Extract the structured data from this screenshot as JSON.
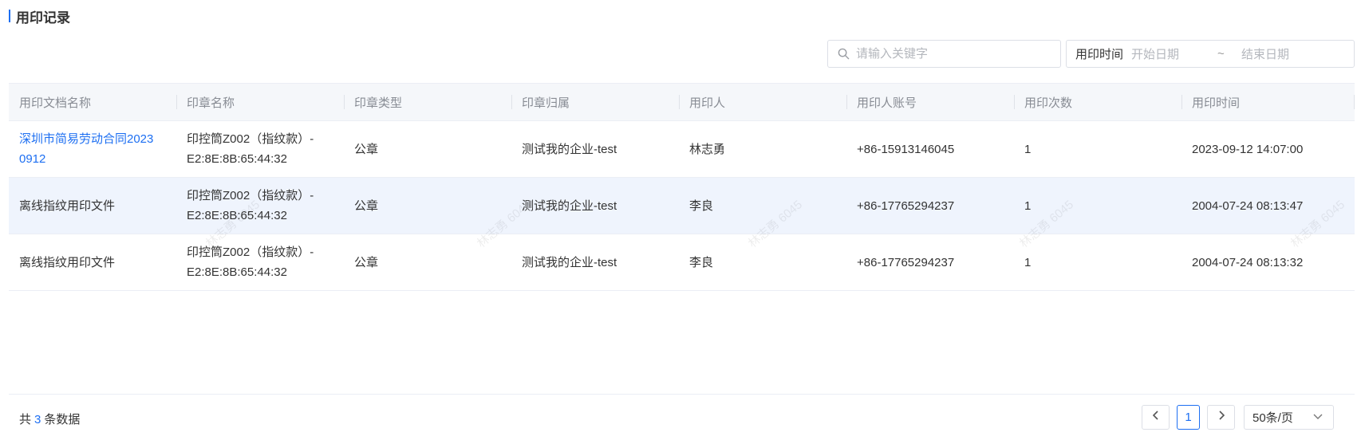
{
  "page": {
    "title": "用印记录"
  },
  "filters": {
    "search_placeholder": "请输入关键字",
    "date_label": "用印时间",
    "start_placeholder": "开始日期",
    "separator": "~",
    "end_placeholder": "结束日期"
  },
  "table": {
    "columns": [
      "用印文档名称",
      "印章名称",
      "印章类型",
      "印章归属",
      "用印人",
      "用印人账号",
      "用印次数",
      "用印时间"
    ],
    "rows": [
      {
        "doc_name_line1": "深圳市简易劳动合同2023",
        "doc_name_line2": "0912",
        "seal_name_line1": "印控筒Z002（指纹款）-",
        "seal_name_line2": "E2:8E:8B:65:44:32",
        "seal_type": "公章",
        "seal_owner": "测试我的企业-test",
        "user": "林志勇",
        "account": "+86-15913146045",
        "times": "1",
        "time": "2023-09-12 14:07:00"
      },
      {
        "doc_name_line1": "离线指纹用印文件",
        "doc_name_line2": "",
        "seal_name_line1": "印控筒Z002（指纹款）-",
        "seal_name_line2": "E2:8E:8B:65:44:32",
        "seal_type": "公章",
        "seal_owner": "测试我的企业-test",
        "user": "李良",
        "account": "+86-17765294237",
        "times": "1",
        "time": "2004-07-24 08:13:47"
      },
      {
        "doc_name_line1": "离线指纹用印文件",
        "doc_name_line2": "",
        "seal_name_line1": "印控筒Z002（指纹款）-",
        "seal_name_line2": "E2:8E:8B:65:44:32",
        "seal_type": "公章",
        "seal_owner": "测试我的企业-test",
        "user": "李良",
        "account": "+86-17765294237",
        "times": "1",
        "time": "2004-07-24 08:13:32"
      }
    ]
  },
  "watermark": {
    "text": "林志勇 6045"
  },
  "pagination": {
    "total_prefix": "共",
    "total_count": "3",
    "total_suffix": "条数据",
    "current_page": "1",
    "page_size": "50条/页"
  },
  "colors": {
    "accent": "#1d6ff2",
    "header_bg": "#f5f7fa",
    "row_hover": "#eff4fd"
  }
}
